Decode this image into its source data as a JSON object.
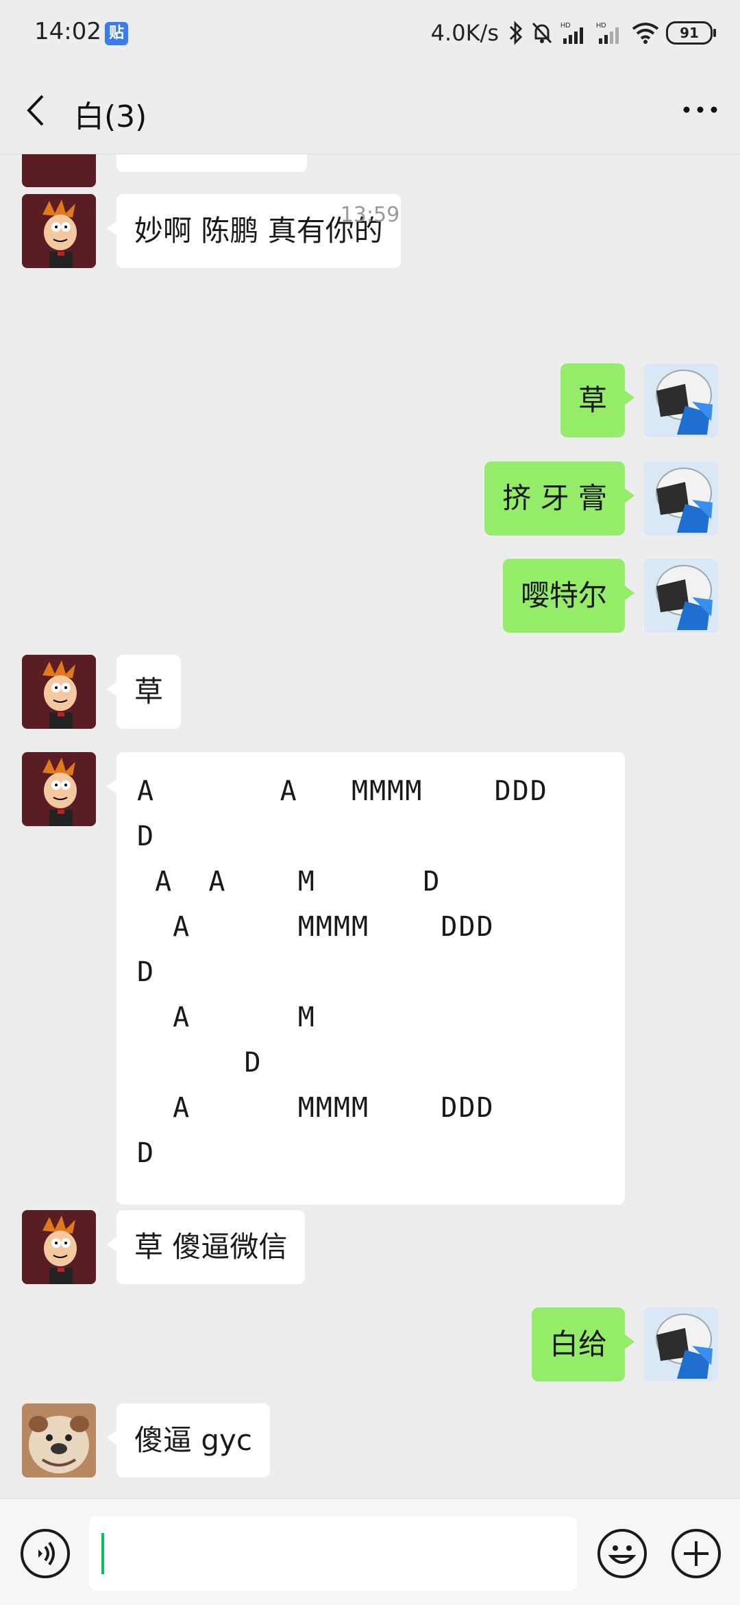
{
  "status_bar": {
    "time": "14:02",
    "app_badge": "贴",
    "net_speed": "4.0K/s",
    "battery": "91"
  },
  "header": {
    "title": "白(3)"
  },
  "messages": [
    {
      "side": "in",
      "avatar": "fry-avatar",
      "text": "妙啊 陈鹏 真有你的"
    },
    {
      "type": "time",
      "text": "13:59"
    },
    {
      "side": "out",
      "avatar": "robot-avatar",
      "text": "草"
    },
    {
      "side": "out",
      "avatar": "robot-avatar",
      "text": "挤 牙 膏"
    },
    {
      "side": "out",
      "avatar": "robot-avatar",
      "text": "嘤特尔"
    },
    {
      "side": "in",
      "avatar": "fry-avatar",
      "text": "草"
    },
    {
      "side": "in",
      "avatar": "fry-avatar",
      "text": "A       A   MMMM    DDD\nD\n A  A    M      D\n  A      MMMM    DDD\nD\n  A      M\n      D\n  A      MMMM    DDD\nD"
    },
    {
      "side": "in",
      "avatar": "fry-avatar",
      "text": "草 傻逼微信"
    },
    {
      "side": "out",
      "avatar": "robot-avatar",
      "text": "白给"
    },
    {
      "side": "in",
      "avatar": "dog-avatar",
      "text": "傻逼 gyc"
    }
  ],
  "colors": {
    "outgoing_bubble": "#95ec69",
    "incoming_bubble": "#ffffff",
    "background": "#ededed",
    "caret": "#07c160"
  }
}
